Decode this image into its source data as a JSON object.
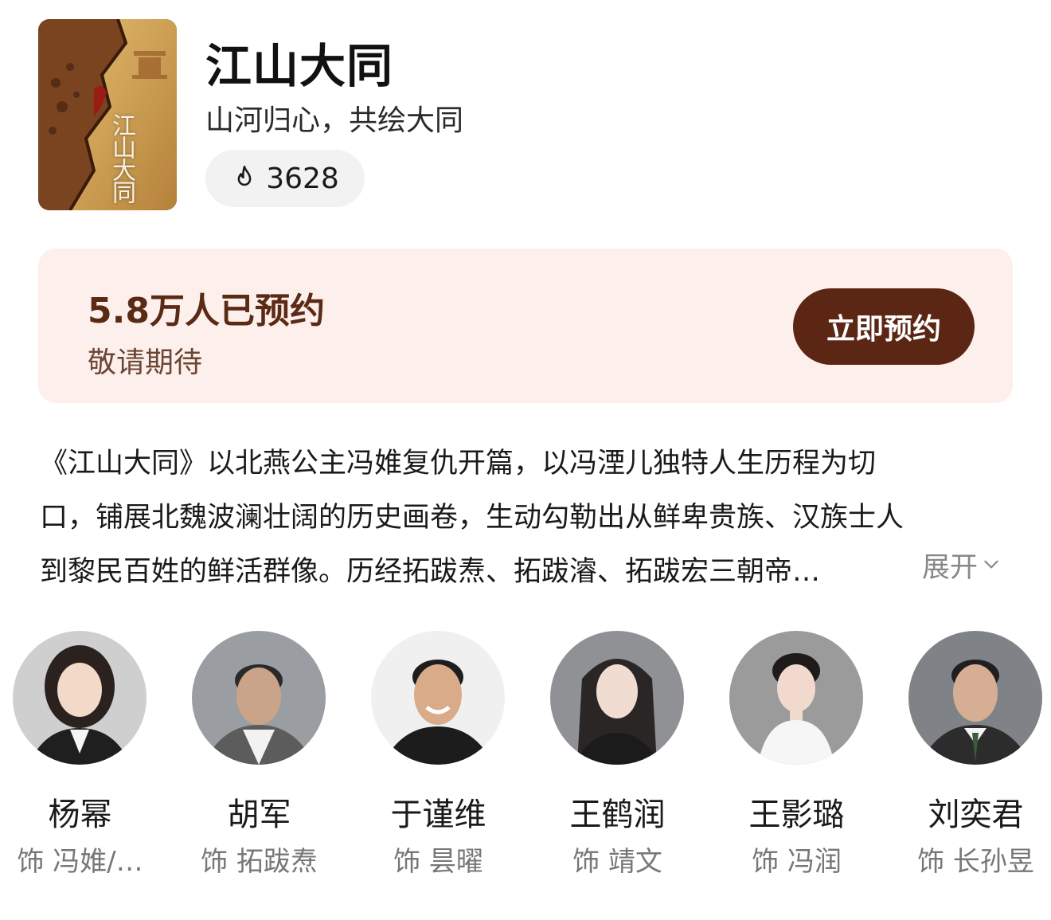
{
  "show": {
    "title": "江山大同",
    "subtitle": "山河归心，共绘大同",
    "heat_count": "3628",
    "poster_calligraphy": "江山大同"
  },
  "reservation": {
    "count_text": "5.8万人已预约",
    "sub_text": "敬请期待",
    "button_label": "立即预约"
  },
  "description": {
    "lines": [
      "《江山大同》以北燕公主冯婎复仇开篇，以冯湮儿独特人生历程为切",
      "口，铺展北魏波澜壮阔的历史画卷，生动勾勒出从鲜卑贵族、汉族士人",
      "到黎民百姓的鲜活群像。历经拓跋焘、拓跋濬、拓跋宏三朝帝…"
    ],
    "expand_label": "展开"
  },
  "cast": [
    {
      "name": "杨幂",
      "role": "饰 冯婎/…"
    },
    {
      "name": "胡军",
      "role": "饰 拓跋焘"
    },
    {
      "name": "于谨维",
      "role": "饰 昙曜"
    },
    {
      "name": "王鹤润",
      "role": "饰 靖文"
    },
    {
      "name": "王影璐",
      "role": "饰 冯润"
    },
    {
      "name": "刘奕君",
      "role": "饰 长孙昱"
    }
  ],
  "colors": {
    "accent_brown": "#5b2614",
    "card_bg": "#fdf0ec",
    "pill_bg": "#f2f2f2"
  }
}
